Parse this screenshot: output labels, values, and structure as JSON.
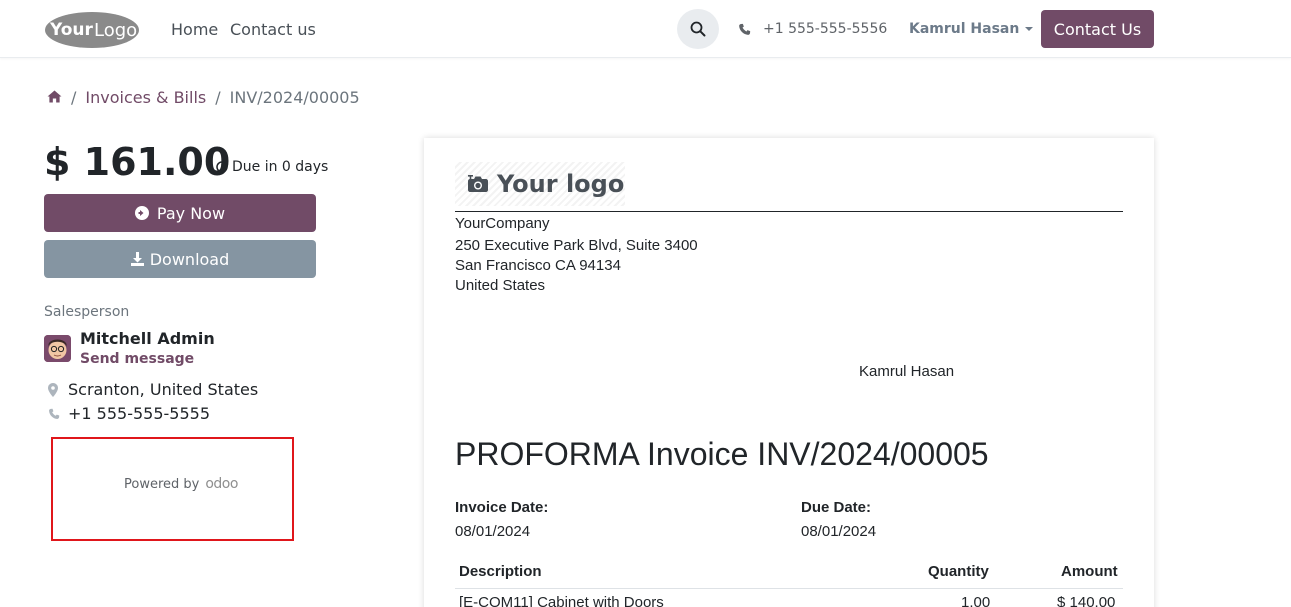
{
  "header": {
    "logo_text": "YourLogo",
    "nav": {
      "home": "Home",
      "contact": "Contact us"
    },
    "phone": "+1 555-555-5556",
    "user": "Kamrul Hasan",
    "contact_button": "Contact Us",
    "icons": {
      "search": "search-icon",
      "phone": "phone-icon",
      "caret": "chevron-down-icon"
    },
    "accent_color": "#714B67"
  },
  "breadcrumb": {
    "home_icon": "home-icon",
    "items": [
      "Invoices & Bills",
      "INV/2024/00005"
    ]
  },
  "summary": {
    "amount": "$ 161.00",
    "due": "Due in 0 days",
    "pay_now": "Pay Now",
    "download": "Download"
  },
  "salesperson": {
    "label": "Salesperson",
    "name": "Mitchell Admin",
    "send_message": "Send message",
    "location": "Scranton, United States",
    "phone": "+1 555-555-5555"
  },
  "powered": {
    "label": "Powered by",
    "brand": "odoo"
  },
  "invoice": {
    "logo_text": "Your logo",
    "company": "YourCompany",
    "address": [
      "250 Executive Park Blvd, Suite 3400",
      "San Francisco CA 94134",
      "United States"
    ],
    "customer": "Kamrul Hasan",
    "title": "PROFORMA Invoice INV/2024/00005",
    "invoice_date_label": "Invoice Date:",
    "invoice_date": "08/01/2024",
    "due_date_label": "Due Date:",
    "due_date": "08/01/2024",
    "columns": [
      "Description",
      "Quantity",
      "Amount"
    ],
    "lines": [
      {
        "description": "[E-COM11] Cabinet with Doors",
        "quantity": "1.00",
        "amount": "$ 140.00"
      }
    ]
  }
}
